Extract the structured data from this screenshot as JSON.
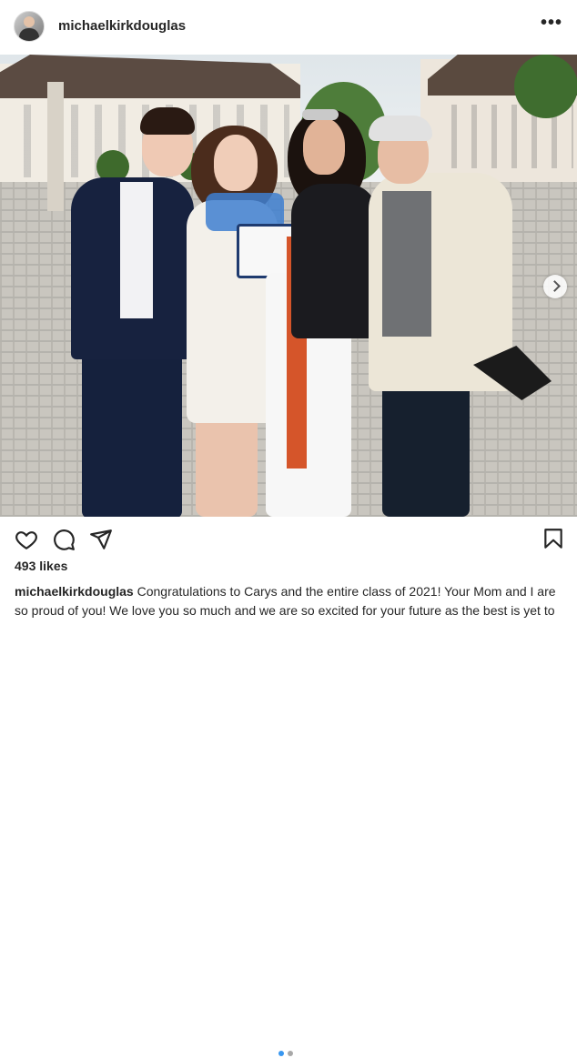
{
  "post": {
    "username": "michaelkirkdouglas",
    "more_label": "•••",
    "likes": "493 likes",
    "caption_user": "michaelkirkdouglas",
    "caption_text": " Congratulations to Carys and the entire class of 2021! Your Mom and I are so proud of you! We love you so much and we are so excited for your future as the best is yet to come! ❤️ Dad"
  },
  "carousel": {
    "active_index": 1,
    "count": 2
  },
  "icons": {
    "heart": "heart-icon",
    "comment": "comment-icon",
    "share": "paper-plane-icon",
    "bookmark": "bookmark-icon",
    "next": "chevron-right-icon",
    "more": "more-icon"
  },
  "colors": {
    "text": "#262626",
    "accent": "#3897f0"
  }
}
